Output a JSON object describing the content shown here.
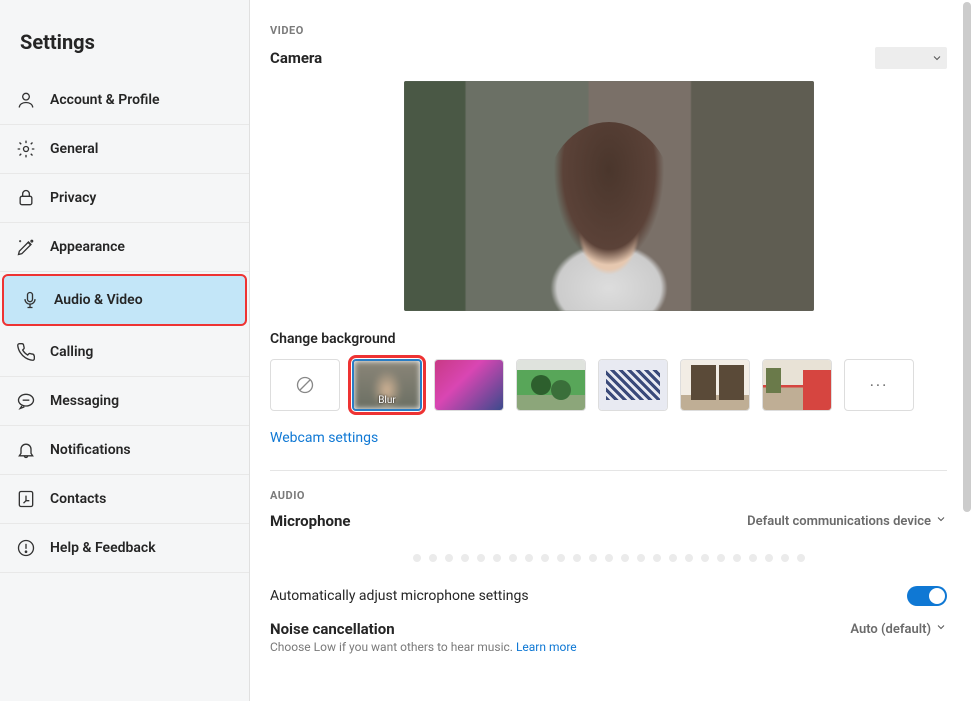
{
  "sidebar": {
    "title": "Settings",
    "items": [
      {
        "label": "Account & Profile",
        "name": "sidebar-item-account-profile"
      },
      {
        "label": "General",
        "name": "sidebar-item-general"
      },
      {
        "label": "Privacy",
        "name": "sidebar-item-privacy"
      },
      {
        "label": "Appearance",
        "name": "sidebar-item-appearance"
      },
      {
        "label": "Audio & Video",
        "name": "sidebar-item-audio-video",
        "active": true
      },
      {
        "label": "Calling",
        "name": "sidebar-item-calling"
      },
      {
        "label": "Messaging",
        "name": "sidebar-item-messaging"
      },
      {
        "label": "Notifications",
        "name": "sidebar-item-notifications"
      },
      {
        "label": "Contacts",
        "name": "sidebar-item-contacts"
      },
      {
        "label": "Help & Feedback",
        "name": "sidebar-item-help-feedback"
      }
    ]
  },
  "video": {
    "section_label": "VIDEO",
    "title": "Camera",
    "change_bg_label": "Change background",
    "blur_label": "Blur",
    "more_label": "···",
    "webcam_settings": "Webcam settings"
  },
  "audio": {
    "section_label": "AUDIO",
    "mic_label": "Microphone",
    "mic_value": "Default communications device",
    "auto_adjust": "Automatically adjust microphone settings",
    "noise_title": "Noise cancellation",
    "noise_value": "Auto (default)",
    "noise_sub": "Choose Low if you want others to hear music.",
    "learn_more": "Learn more"
  }
}
